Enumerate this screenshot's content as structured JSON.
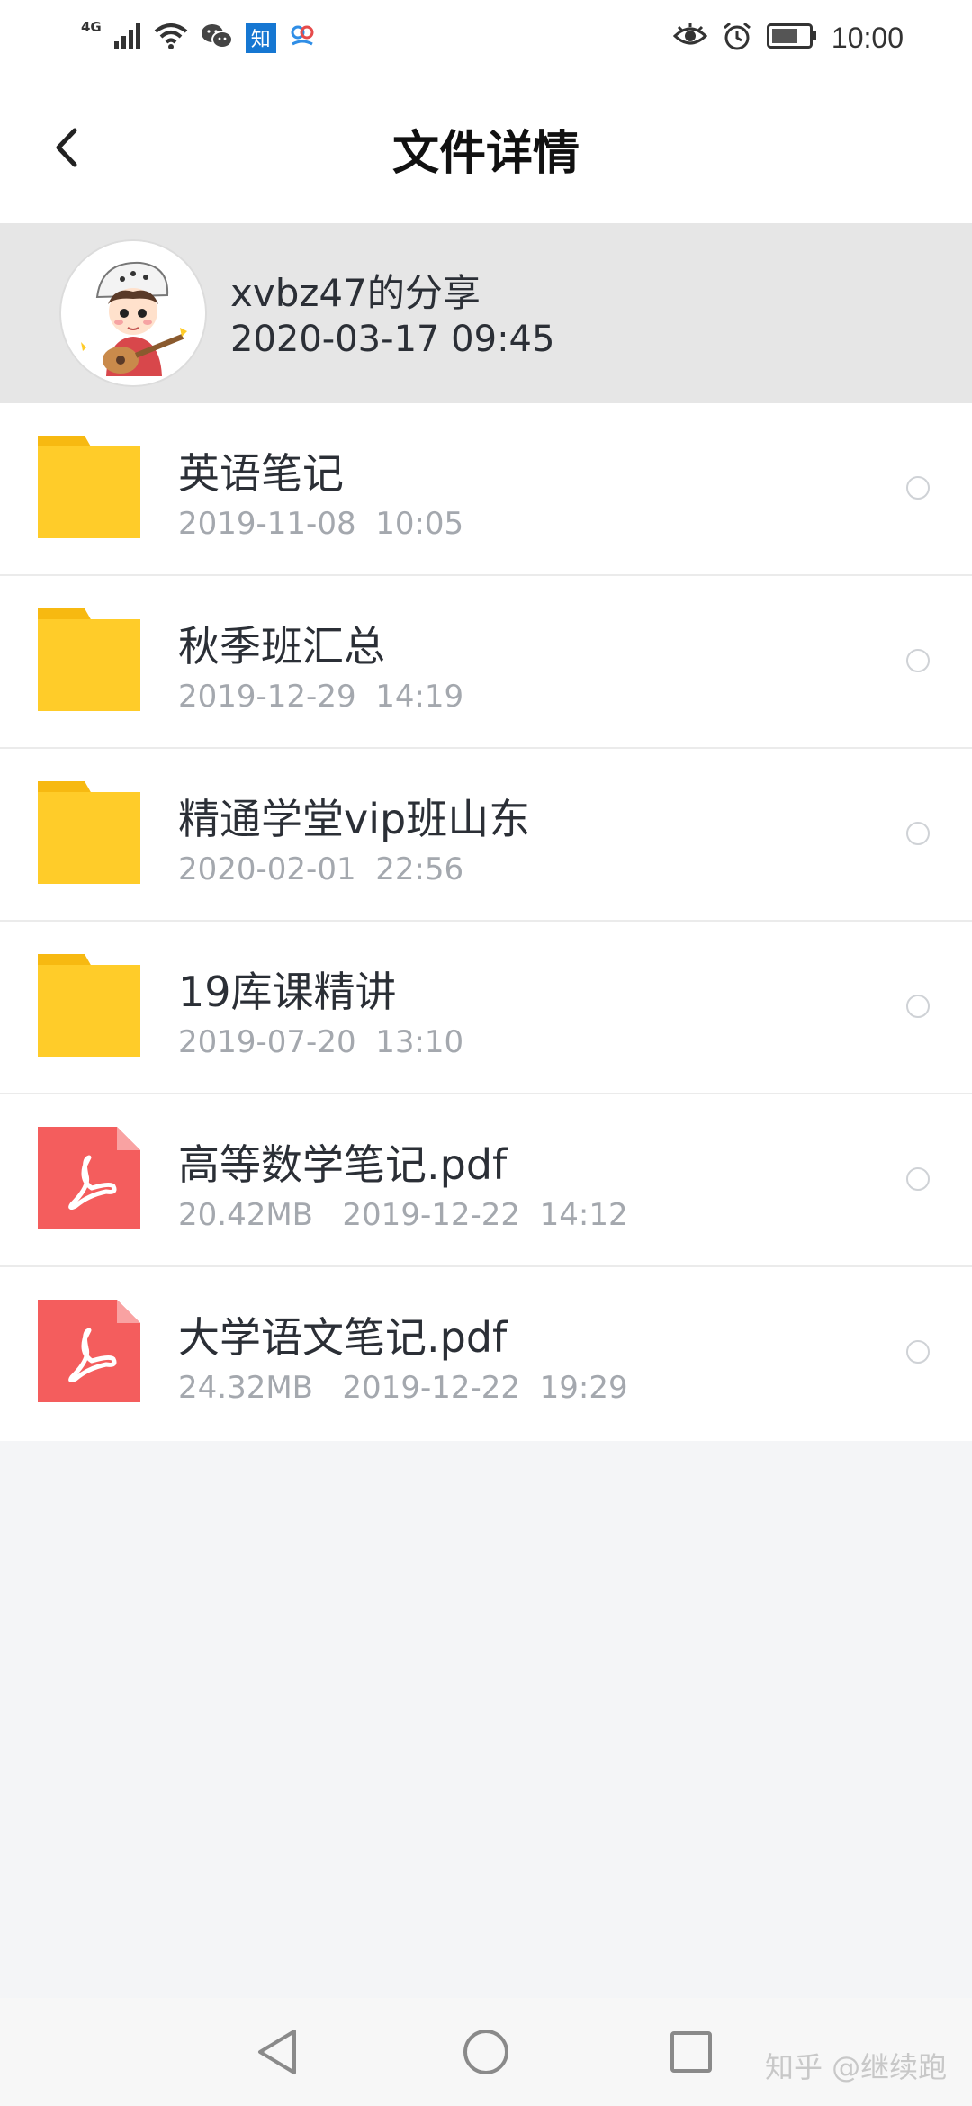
{
  "status_bar": {
    "network": "4G",
    "icons": [
      "signal-icon",
      "wifi-icon",
      "wechat-icon",
      "zhihu-icon",
      "baidu-netdisk-icon",
      "eye-icon",
      "alarm-icon",
      "battery-icon"
    ],
    "zhihu_label": "知",
    "time": "10:00"
  },
  "header": {
    "title": "文件详情",
    "back_icon": "chevron-left-icon"
  },
  "share": {
    "owner": "xvbz47的分享",
    "time": "2020-03-17  09:45",
    "avatar_icon": "cartoon-avatar"
  },
  "files": [
    {
      "type": "folder",
      "name": "英语笔记",
      "meta": "2019-11-08  10:05"
    },
    {
      "type": "folder",
      "name": "秋季班汇总",
      "meta": "2019-12-29  14:19"
    },
    {
      "type": "folder",
      "name": "精通学堂vip班山东",
      "meta": "2020-02-01  22:56"
    },
    {
      "type": "folder",
      "name": "19库课精讲",
      "meta": "2019-07-20  13:10"
    },
    {
      "type": "pdf",
      "name": "高等数学笔记.pdf",
      "meta": "20.42MB   2019-12-22  14:12"
    },
    {
      "type": "pdf",
      "name": "大学语文笔记.pdf",
      "meta": "24.32MB   2019-12-22  19:29"
    }
  ],
  "colors": {
    "folder": "#ffcc29",
    "folder_tab": "#f7b911",
    "pdf": "#f45d5d",
    "share_bg": "#e6e6e6",
    "page_bg": "#f4f5f7"
  },
  "nav": {
    "icons": [
      "back-triangle-icon",
      "home-circle-icon",
      "recents-square-icon"
    ]
  },
  "watermark": "知乎 @继续跑"
}
